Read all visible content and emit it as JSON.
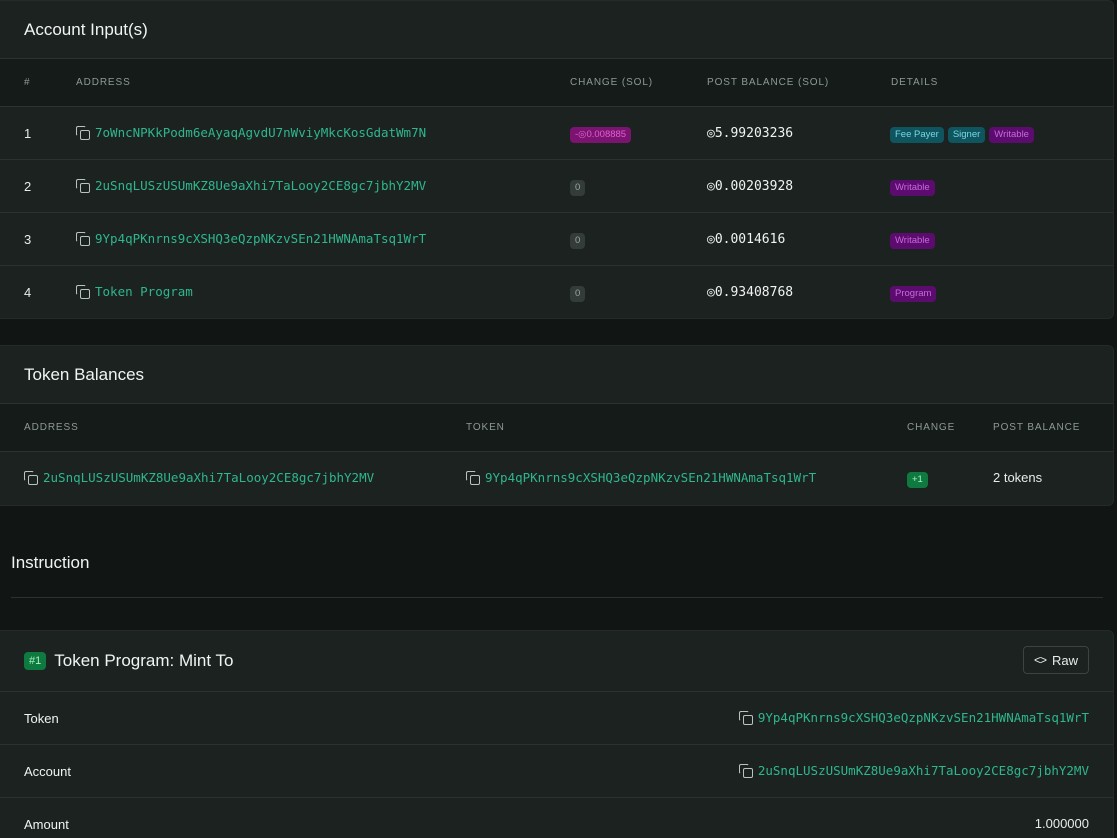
{
  "account_inputs": {
    "title": "Account Input(s)",
    "columns": [
      "#",
      "ADDRESS",
      "CHANGE (SOL)",
      "POST BALANCE (SOL)",
      "DETAILS"
    ],
    "rows": [
      {
        "index": "1",
        "address": "7oWncNPKkPodm6eAyaqAgvdU7nWviyMkcKosGdatWm7N",
        "change": "-◎0.008885",
        "change_color": "#7a1470",
        "post_balance": "◎5.99203236",
        "details": [
          "Fee Payer",
          "Signer",
          "Writable"
        ]
      },
      {
        "index": "2",
        "address": "2uSnqLUSzUSUmKZ8Ue9aXhi7TaLooy2CE8gc7jbhY2MV",
        "change": "0",
        "change_color": "#343c3a",
        "post_balance": "◎0.00203928",
        "details": [
          "Writable"
        ]
      },
      {
        "index": "3",
        "address": "9Yp4qPKnrns9cXSHQ3eQzpNKzvSEn21HWNAmaTsq1WrT",
        "change": "0",
        "change_color": "#343c3a",
        "post_balance": "◎0.0014616",
        "details": [
          "Writable"
        ]
      },
      {
        "index": "4",
        "address": "Token Program",
        "change": "0",
        "change_color": "#343c3a",
        "post_balance": "◎0.93408768",
        "details": [
          "Program"
        ]
      }
    ]
  },
  "token_balances": {
    "title": "Token Balances",
    "columns": [
      "ADDRESS",
      "TOKEN",
      "CHANGE",
      "POST BALANCE"
    ],
    "rows": [
      {
        "address": "2uSnqLUSzUSUmKZ8Ue9aXhi7TaLooy2CE8gc7jbhY2MV",
        "token": "9Yp4qPKnrns9cXSHQ3eQzpNKzvSEn21HWNAmaTsq1WrT",
        "change": "+1",
        "post_balance": "2 tokens"
      }
    ]
  },
  "instruction": {
    "section_title": "Instruction",
    "badge": "#1",
    "title": "Token Program: Mint To",
    "raw_label": "Raw",
    "raw_icon": "code-icon",
    "fields": [
      {
        "label": "Token",
        "value": "9Yp4qPKnrns9cXSHQ3eQzpNKzvSEn21HWNAmaTsq1WrT",
        "is_address": true
      },
      {
        "label": "Account",
        "value": "2uSnqLUSzUSUmKZ8Ue9aXhi7TaLooy2CE8gc7jbhY2MV",
        "is_address": true
      },
      {
        "label": "Amount",
        "value": "1.000000",
        "is_address": false
      }
    ]
  },
  "colors": {
    "background": "#111614",
    "card": "#1b2220",
    "address_link": "#2fb68e",
    "badge_fee_payer": "#0e5560",
    "badge_writable": "#5c0c6e",
    "badge_change_positive": "#0f7a3f"
  }
}
